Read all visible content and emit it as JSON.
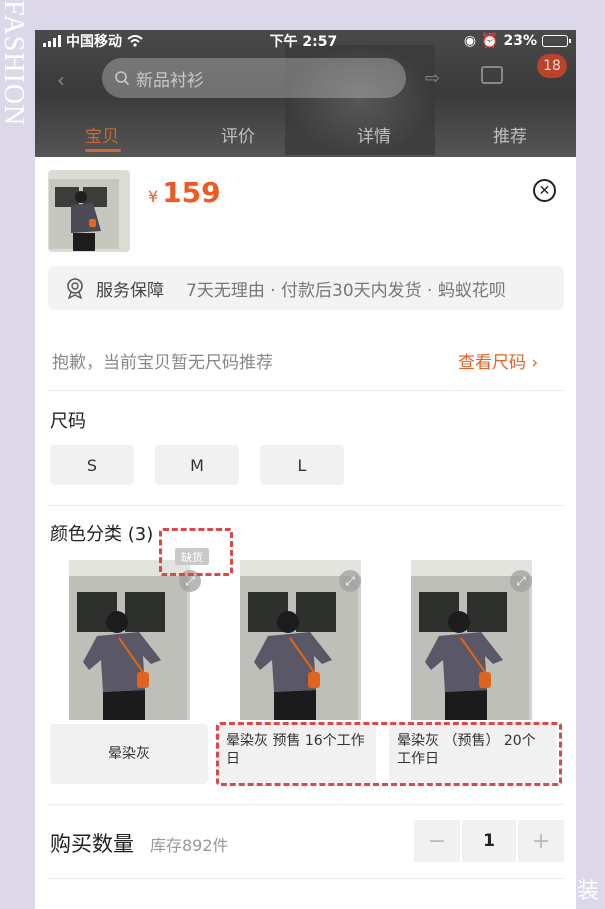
{
  "decor": {
    "side_text": "FASHION",
    "corner_text": "装"
  },
  "status_bar": {
    "carrier": "中国移动",
    "time": "下午 2:57",
    "battery": "23%",
    "battery_level": 0.23
  },
  "header": {
    "search_placeholder": "新品衬衫",
    "cart_count": "18",
    "tabs": [
      {
        "label": "宝贝",
        "active": true
      },
      {
        "label": "评价",
        "active": false
      },
      {
        "label": "详情",
        "active": false
      },
      {
        "label": "推荐",
        "active": false
      }
    ]
  },
  "sku": {
    "currency": "¥",
    "price": "159",
    "service": {
      "title": "服务保障",
      "desc": "7天无理由 · 付款后30天内发货 · 蚂蚁花呗"
    },
    "size_hint": "抱歉，当前宝贝暂无尺码推荐",
    "size_link": "查看尺码 ›",
    "size_label": "尺码",
    "sizes": [
      "S",
      "M",
      "L"
    ],
    "color_label": "颜色分类 (3)",
    "stock_out_tag": "缺货",
    "colors": [
      {
        "name": "晕染灰"
      },
      {
        "name": "晕染灰 预售 16个工作日"
      },
      {
        "name": "晕染灰 （预售） 20个工作日"
      }
    ],
    "quantity_label": "购买数量",
    "stock_text": "库存892件",
    "quantity": "1",
    "minus": "−",
    "plus": "+"
  },
  "colors": {
    "accent": "#f05a22",
    "highlight": "#d84a4a",
    "background": "#ddd7ea"
  }
}
